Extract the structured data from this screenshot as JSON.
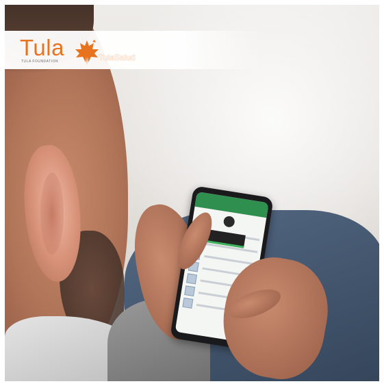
{
  "banner": {
    "brand": "Tula",
    "foundation": "TULA FOUNDATION",
    "program": "TulaSalud",
    "brand_color": "#e8731f",
    "logo_icon": "maple-leaf-icon"
  },
  "scene": {
    "subject": "person holding smartphone",
    "phone_accent": "#2f8f4e"
  }
}
